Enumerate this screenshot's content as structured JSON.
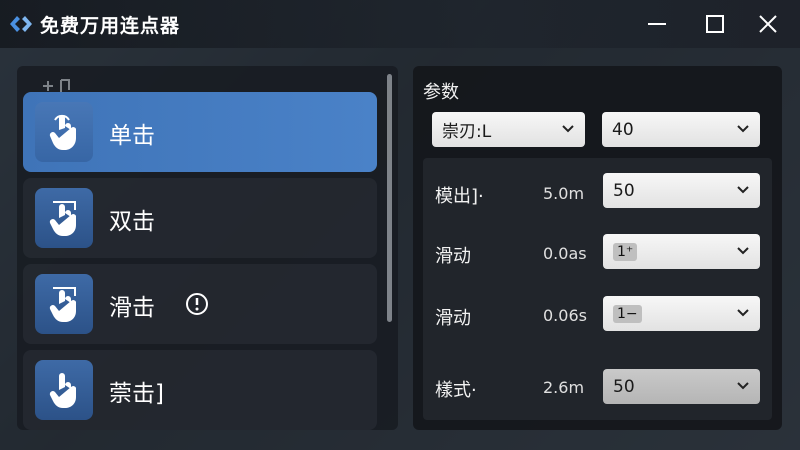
{
  "window": {
    "title": "免费万用连点器"
  },
  "actions": [
    {
      "label": "单击",
      "selected": true
    },
    {
      "label": "双击",
      "selected": false
    },
    {
      "label": "滑击",
      "selected": false,
      "has_info": true
    },
    {
      "label": "萗击]",
      "selected": false
    }
  ],
  "params": {
    "title": "参数",
    "top_select_left": "崇刃:L",
    "top_select_right": "40",
    "rows": [
      {
        "label": "模出]·",
        "value": "5.0m",
        "select": "50"
      },
      {
        "label": "滑动",
        "value": "0.0as",
        "select": "1⁺"
      },
      {
        "label": "滑动",
        "value": "0.06s",
        "select": "1−"
      },
      {
        "label": "樣式·",
        "value": "2.6m",
        "select": "50"
      }
    ]
  },
  "colors": {
    "accent": "#4a82c8",
    "icon_tile": "#2c5288",
    "panel": "#16191e"
  },
  "icons": [
    "app-logo-icon",
    "minimize-icon",
    "maximize-icon",
    "close-icon",
    "hand-pointer-icon",
    "info-icon",
    "chevron-down-icon"
  ]
}
